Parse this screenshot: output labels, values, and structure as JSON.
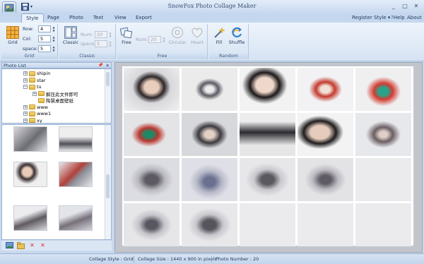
{
  "window": {
    "title": "SnowFox Photo Collage Maker",
    "controls": [
      "_",
      "□",
      "✕"
    ]
  },
  "menu_tabs": [
    "Style",
    "Page",
    "Photo",
    "Text",
    "View",
    "Export"
  ],
  "active_tab": "Style",
  "right_links": {
    "register": "Register",
    "style": "Style ▾",
    "help": "Help",
    "about": "About"
  },
  "ribbon": {
    "grid_group": {
      "label": "Grid",
      "button": "Grid",
      "row_label": "Row:",
      "row_value": "4",
      "col_label": "Col:",
      "col_value": "5",
      "space_label": "space:",
      "space_value": "5"
    },
    "classic_group": {
      "label": "Classic",
      "button": "Classic",
      "num_label": "Num:",
      "num_value": "20",
      "space_label": "space:",
      "space_value": "5"
    },
    "free_group": {
      "label": "Free",
      "free_button": "Free",
      "num_label": "Num:",
      "num_value": "20",
      "circular_button": "Circular",
      "heart_button": "Heart"
    },
    "random_group": {
      "label": "Random",
      "fill_button": "Fill",
      "shuffle_button": "Shuffle"
    }
  },
  "photo_list": {
    "title": "Photo List",
    "pin": "📌",
    "close": "✕",
    "tree": [
      {
        "label": "shipin",
        "indent": 2,
        "expander": "+"
      },
      {
        "label": "star",
        "indent": 2,
        "expander": "+"
      },
      {
        "label": "tu",
        "indent": 2,
        "expander": "−"
      },
      {
        "label": "解压此文件即可",
        "indent": 3,
        "expander": "+"
      },
      {
        "label": "陶慧桌面壁纸",
        "indent": 3,
        "expander": ""
      },
      {
        "label": "www",
        "indent": 2,
        "expander": "+"
      },
      {
        "label": "www1",
        "indent": 2,
        "expander": "+"
      },
      {
        "label": "xy",
        "indent": 2,
        "expander": "+"
      }
    ]
  },
  "status_bar": {
    "collage_style": "Collage Style : Grid",
    "collage_size": "Collage Size : 1440 x 900  in pixels",
    "photo_number": "Photo Number : 20"
  },
  "colors": {
    "accent": "#4a78b5",
    "ribbon_bg": "#e2ecf8",
    "canvas_bg": "#c2c6cc",
    "cell_empty": "#ebebed"
  }
}
